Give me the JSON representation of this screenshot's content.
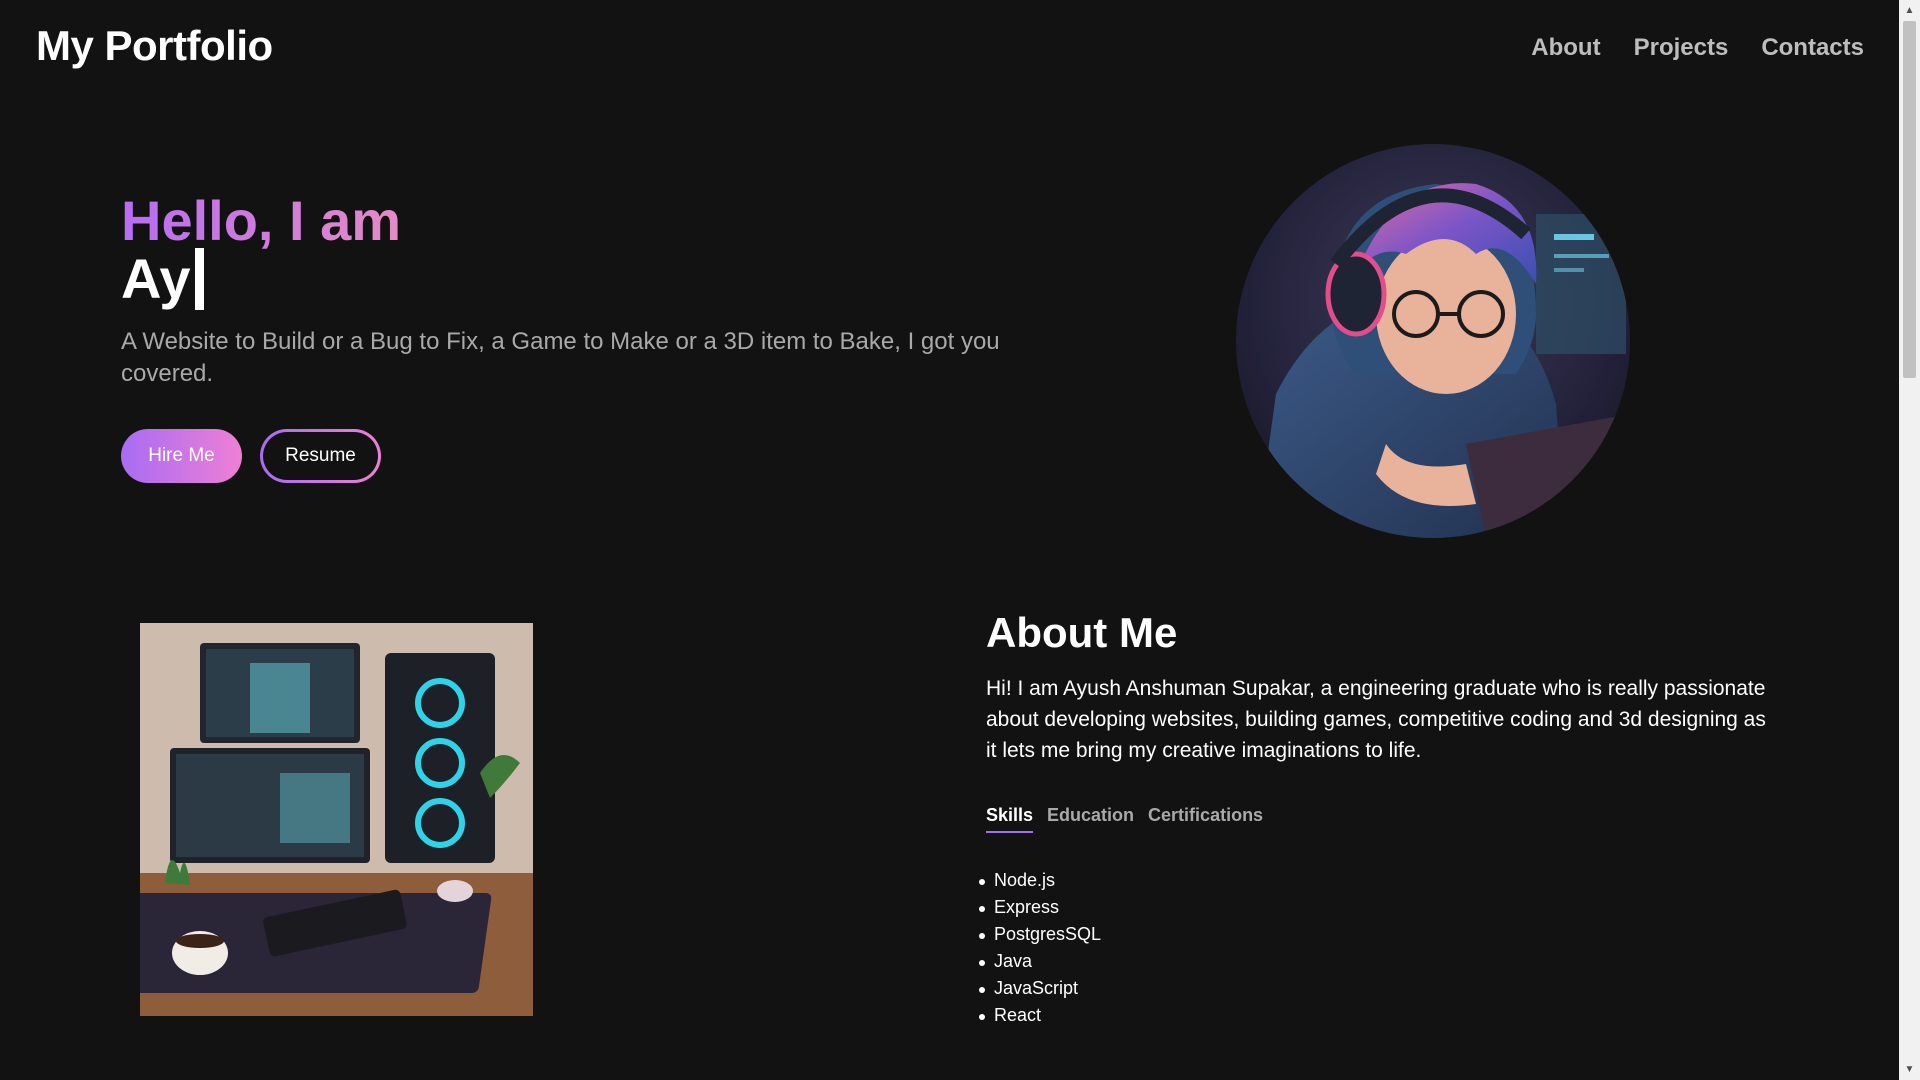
{
  "header": {
    "logo": "My Portfolio",
    "nav": [
      "About",
      "Projects",
      "Contacts"
    ]
  },
  "hero": {
    "greeting": "Hello, I am",
    "typed_name": "Ay",
    "tagline": "A Website to Build or a Bug to Fix, a Game to Make or a 3D item to Bake, I got you covered.",
    "hire_label": "Hire Me",
    "resume_label": "Resume"
  },
  "about": {
    "title": "About Me",
    "text": "Hi! I am Ayush Anshuman Supakar, a engineering graduate who is really passionate about developing websites, building games, competitive coding and 3d designing as it lets me bring my creative imaginations to life.",
    "tabs": [
      "Skills",
      "Education",
      "Certifications"
    ],
    "active_tab": "Skills",
    "skills": [
      "Node.js",
      "Express",
      "PostgresSQL",
      "Java",
      "JavaScript",
      "React"
    ]
  },
  "colors": {
    "background": "#121212",
    "accent_start": "#a86cf3",
    "accent_end": "#ef7fd5",
    "muted_text": "#a9a9a9"
  },
  "icons": {
    "scroll_up": "chevron-up-icon",
    "scroll_down": "chevron-down-icon"
  }
}
